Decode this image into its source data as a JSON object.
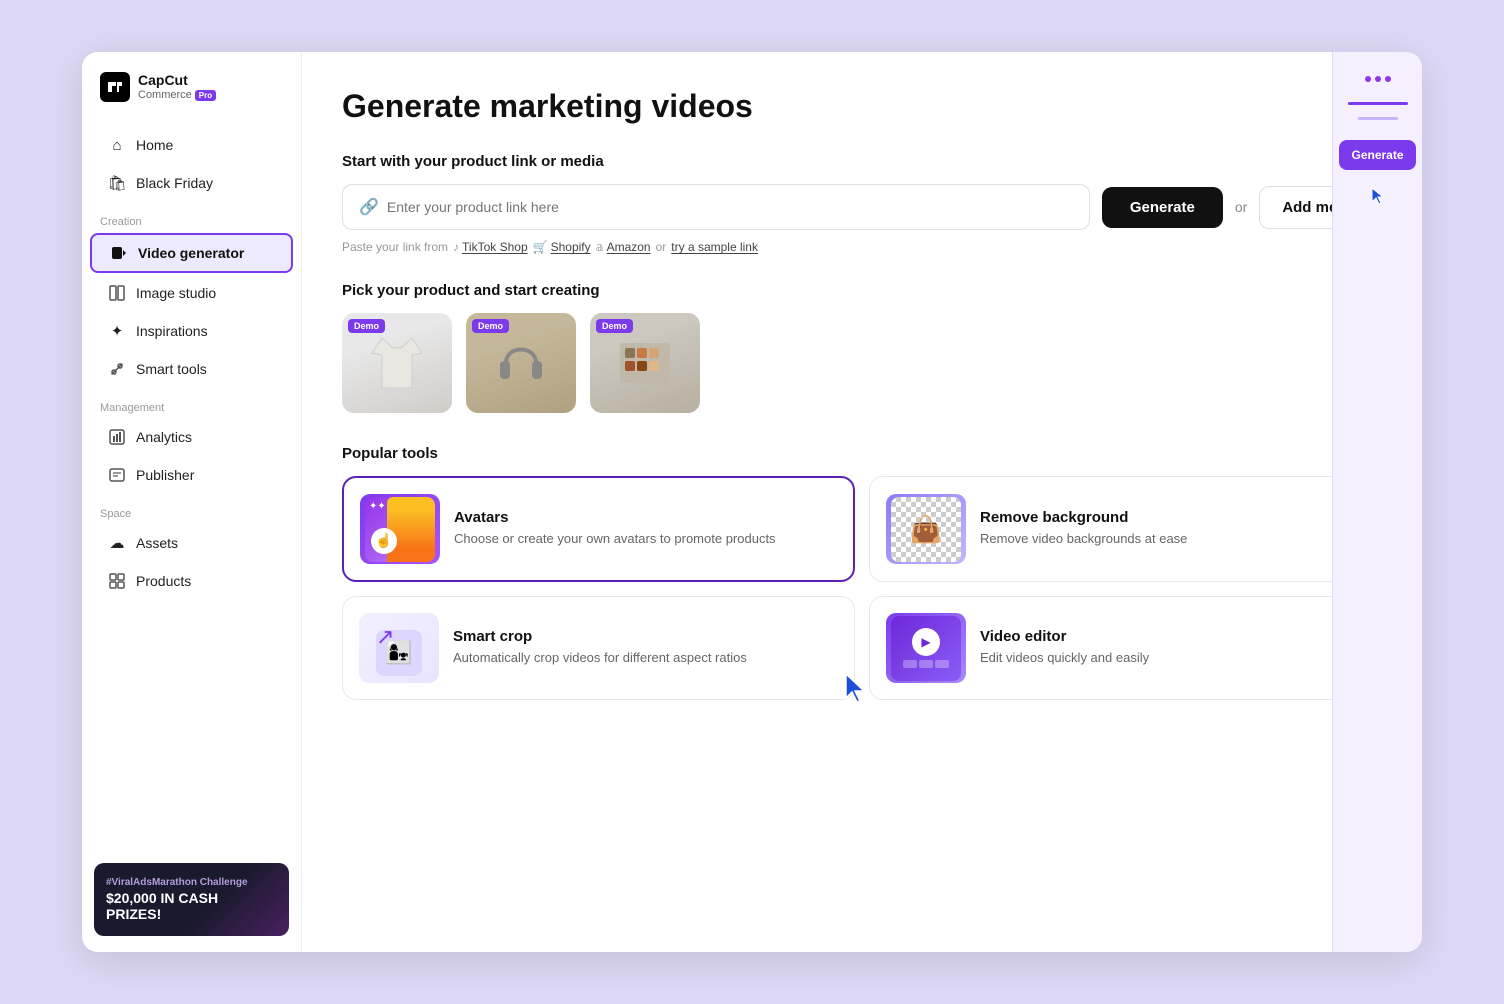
{
  "app": {
    "brand": "CapCut",
    "subbrand": "Commerce",
    "pro_badge": "Pro"
  },
  "sidebar": {
    "nav_items": [
      {
        "id": "home",
        "label": "Home",
        "icon": "home-icon",
        "active": false
      },
      {
        "id": "black-friday",
        "label": "Black Friday",
        "icon": "bag-icon",
        "active": false
      }
    ],
    "creation_label": "Creation",
    "creation_items": [
      {
        "id": "video-generator",
        "label": "Video generator",
        "icon": "video-gen-icon",
        "active": true
      },
      {
        "id": "image-studio",
        "label": "Image studio",
        "icon": "image-icon",
        "active": false
      },
      {
        "id": "inspirations",
        "label": "Inspirations",
        "icon": "inspire-icon",
        "active": false
      },
      {
        "id": "smart-tools",
        "label": "Smart tools",
        "icon": "tools-icon",
        "active": false
      }
    ],
    "management_label": "Management",
    "management_items": [
      {
        "id": "analytics",
        "label": "Analytics",
        "icon": "analytics-icon",
        "active": false
      },
      {
        "id": "publisher",
        "label": "Publisher",
        "icon": "publish-icon",
        "active": false
      }
    ],
    "space_label": "Space",
    "space_items": [
      {
        "id": "assets",
        "label": "Assets",
        "icon": "assets-icon",
        "active": false
      },
      {
        "id": "products",
        "label": "Products",
        "icon": "products-icon",
        "active": false
      }
    ],
    "promo_hashtag": "#ViralAdsMarathon Challenge",
    "promo_amount": "$20,000 IN CASH PRIZES!"
  },
  "main": {
    "title": "Generate marketing videos",
    "input_section": {
      "label": "Start with your product link or media",
      "placeholder": "Enter your product link here",
      "generate_btn": "Generate",
      "or_text": "or",
      "add_media_btn": "Add media"
    },
    "paste_hint": {
      "prefix": "Paste your link from",
      "platforms": [
        "TikTok Shop",
        "Shopify",
        "Amazon"
      ],
      "suffix": "or",
      "sample_link": "try a sample link"
    },
    "products_section": {
      "label": "Pick your product and start creating",
      "products": [
        {
          "id": "shirt",
          "emoji": "👕",
          "demo": true,
          "bg": "shirt"
        },
        {
          "id": "headphones",
          "emoji": "🎧",
          "demo": true,
          "bg": "headphones"
        },
        {
          "id": "makeup",
          "emoji": "🎨",
          "demo": true,
          "bg": "makeup"
        }
      ]
    },
    "tools_section": {
      "label": "Popular tools",
      "tools": [
        {
          "id": "avatars",
          "name": "Avatars",
          "desc": "Choose or create your own avatars to promote products",
          "highlighted": true
        },
        {
          "id": "remove-background",
          "name": "Remove background",
          "desc": "Remove video backgrounds at ease",
          "highlighted": false
        },
        {
          "id": "smart-crop",
          "name": "Smart crop",
          "desc": "Automatically crop videos for different aspect ratios",
          "highlighted": false
        },
        {
          "id": "video-editor",
          "name": "Video editor",
          "desc": "Edit videos quickly and easily",
          "highlighted": false
        }
      ]
    }
  }
}
